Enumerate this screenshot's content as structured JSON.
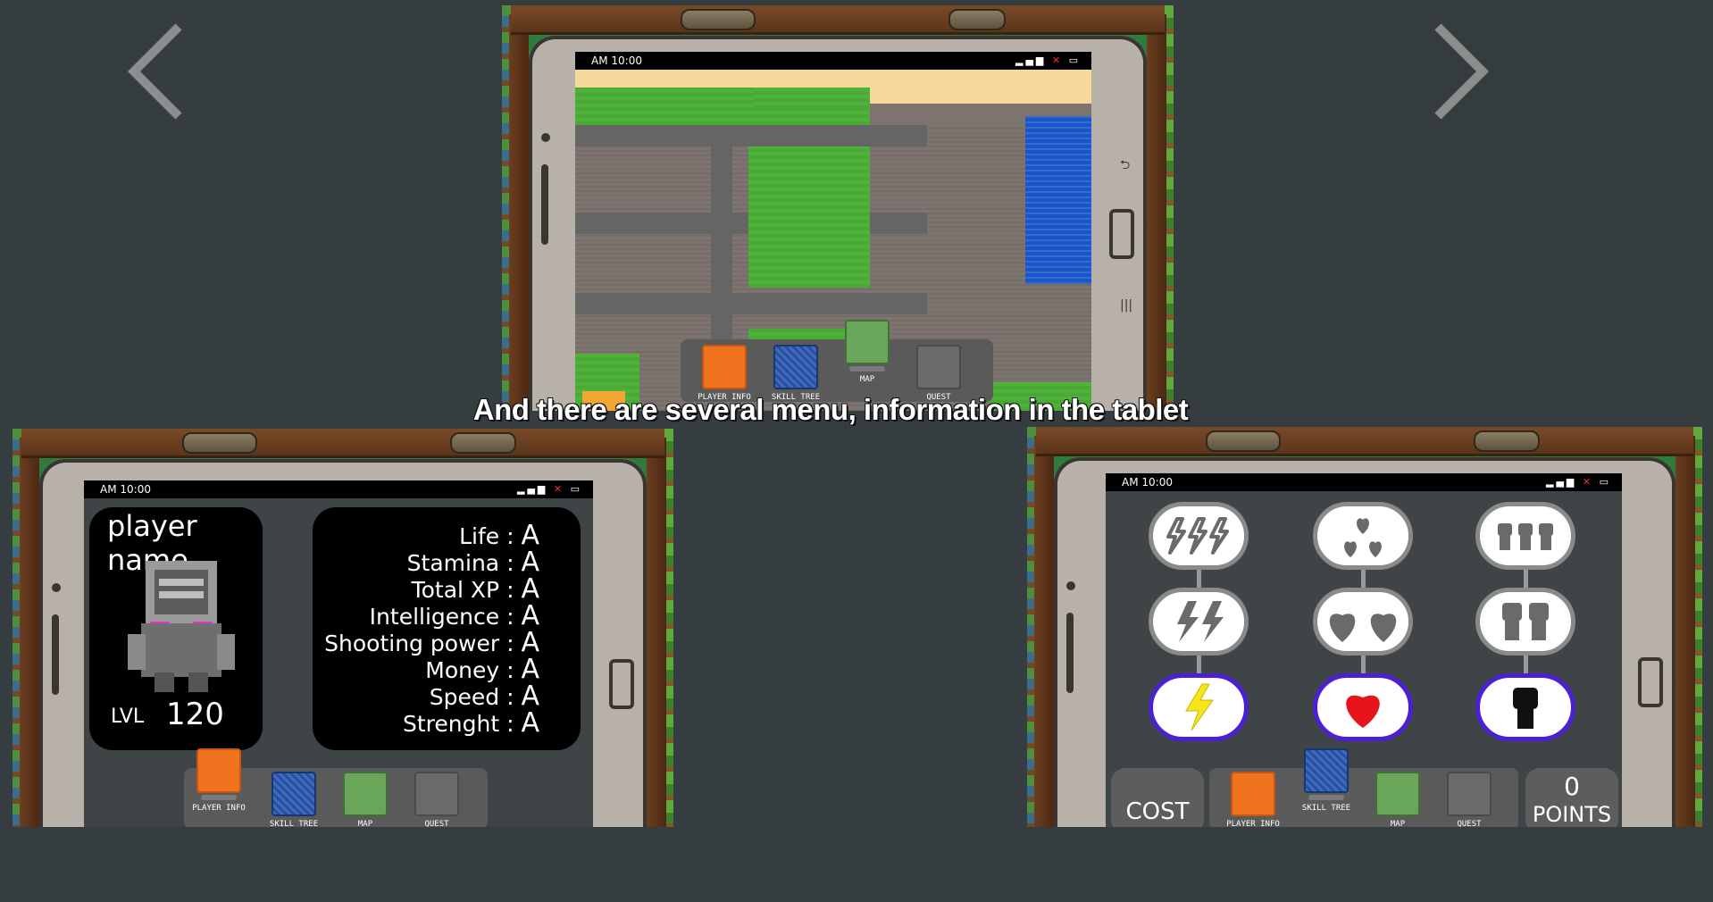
{
  "caption": "And there are several menu, information in the tablet",
  "nav": {
    "prev_icon": "chevron-left-icon",
    "next_icon": "chevron-right-icon"
  },
  "status_bar": {
    "time": "AM 10:00",
    "icons": [
      "signal-icon",
      "no-sync-icon",
      "battery-icon"
    ]
  },
  "dock": {
    "items": [
      {
        "label": "PLAYER INFO",
        "icon": "player-info-icon"
      },
      {
        "label": "SKILL TREE",
        "icon": "skill-tree-icon"
      },
      {
        "label": "MAP",
        "icon": "map-icon"
      },
      {
        "label": "QUEST",
        "icon": "quest-icon"
      }
    ]
  },
  "player_info": {
    "name": "player name",
    "lvl_label": "LVL",
    "lvl_value": "120",
    "stats": [
      {
        "label": "Life",
        "value": "A"
      },
      {
        "label": "Stamina",
        "value": "A"
      },
      {
        "label": "Total XP",
        "value": "A"
      },
      {
        "label": "Intelligence",
        "value": "A"
      },
      {
        "label": "Shooting power",
        "value": "A"
      },
      {
        "label": "Money",
        "value": "A"
      },
      {
        "label": "Speed",
        "value": "A"
      },
      {
        "label": "Strenght",
        "value": "A"
      }
    ]
  },
  "skill_tree": {
    "cost_label": "COST",
    "points_value": "0",
    "points_label": "POINTS",
    "columns": [
      {
        "icon": "lightning-icon",
        "color": "#f5e51a",
        "tiers": [
          3,
          2,
          1
        ]
      },
      {
        "icon": "heart-icon",
        "color": "#e8141b",
        "tiers": [
          3,
          2,
          1
        ]
      },
      {
        "icon": "fist-icon",
        "color": "#111111",
        "tiers": [
          3,
          2,
          1
        ]
      }
    ]
  },
  "colors": {
    "background": "#363d40",
    "skill_active_border": "#4b1fd6",
    "dock_player_info": "#f0731f",
    "dock_skill_tree": "#2350a8"
  }
}
